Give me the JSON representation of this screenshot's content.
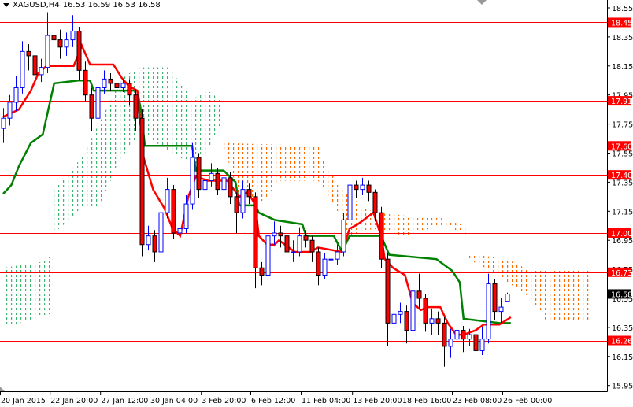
{
  "header": {
    "symbol": "XAGUSD,H4",
    "ohlc": "16.53 16.59 16.53 16.58"
  },
  "colors": {
    "bull": "#0000ff",
    "bear": "#ff0000",
    "tenkan": "#ff0000",
    "kijun": "#008000",
    "cloud_bull": "#3cb371",
    "cloud_bear": "#ff6a00",
    "level": "#ff0000",
    "current": "#708090"
  },
  "chart_data": {
    "type": "candlestick",
    "title": "XAGUSD,H4",
    "ylim": [
      15.9,
      18.6
    ],
    "y_ticks": [
      "18.55",
      "18.35",
      "18.15",
      "17.95",
      "17.75",
      "17.55",
      "17.35",
      "17.15",
      "16.95",
      "16.75",
      "16.55",
      "16.35",
      "16.15",
      "15.95"
    ],
    "x_ticks": [
      {
        "i": 0,
        "label": "20 Jan 2015"
      },
      {
        "i": 7.9,
        "label": "22 Jan 20:00"
      },
      {
        "i": 15.9,
        "label": "27 Jan 12:00"
      },
      {
        "i": 23.75,
        "label": "30 Jan 04:00"
      },
      {
        "i": 31.9,
        "label": "3 Feb 20:00"
      },
      {
        "i": 39.75,
        "label": "6 Feb 12:00"
      },
      {
        "i": 47.75,
        "label": "11 Feb 04:00"
      },
      {
        "i": 55.9,
        "label": "13 Feb 20:00"
      },
      {
        "i": 63.75,
        "label": "18 Feb 16:00"
      },
      {
        "i": 71.75,
        "label": "23 Feb 08:00"
      },
      {
        "i": 79.75,
        "label": "26 Feb 00:00"
      }
    ],
    "levels": [
      {
        "price": 18.45,
        "label": "18.45"
      },
      {
        "price": 17.91,
        "label": "17.91"
      },
      {
        "price": 17.6,
        "label": "17.60"
      },
      {
        "price": 17.4,
        "label": "17.40"
      },
      {
        "price": 17.0,
        "label": "17.00"
      },
      {
        "price": 16.73,
        "label": "16.73"
      },
      {
        "price": 16.26,
        "label": "16.26"
      }
    ],
    "current_price": {
      "price": 16.58,
      "label": "16.58"
    },
    "candles": [
      [
        17.72,
        17.86,
        17.62,
        17.79
      ],
      [
        17.79,
        17.95,
        17.74,
        17.9
      ],
      [
        17.9,
        18.08,
        17.84,
        18.0
      ],
      [
        18.0,
        18.32,
        17.96,
        18.25
      ],
      [
        18.25,
        18.3,
        18.12,
        18.22
      ],
      [
        18.22,
        18.26,
        18.02,
        18.09
      ],
      [
        18.09,
        18.2,
        18.04,
        18.14
      ],
      [
        18.14,
        18.52,
        18.1,
        18.36
      ],
      [
        18.36,
        18.42,
        18.26,
        18.33
      ],
      [
        18.33,
        18.4,
        18.2,
        18.28
      ],
      [
        18.28,
        18.38,
        18.22,
        18.33
      ],
      [
        18.33,
        18.5,
        18.28,
        18.39
      ],
      [
        18.39,
        18.42,
        18.05,
        18.12
      ],
      [
        18.12,
        18.18,
        17.9,
        17.95
      ],
      [
        17.95,
        18.0,
        17.7,
        17.79
      ],
      [
        17.79,
        18.05,
        17.75,
        18.0
      ],
      [
        18.0,
        18.12,
        17.96,
        18.06
      ],
      [
        18.06,
        18.1,
        17.98,
        18.03
      ],
      [
        18.03,
        18.08,
        17.94,
        18.0
      ],
      [
        18.0,
        18.06,
        17.97,
        18.03
      ],
      [
        18.03,
        18.06,
        17.88,
        17.95
      ],
      [
        17.95,
        17.99,
        17.7,
        17.79
      ],
      [
        17.79,
        17.85,
        16.84,
        16.92
      ],
      [
        16.92,
        17.05,
        16.88,
        16.98
      ],
      [
        16.98,
        17.02,
        16.8,
        16.87
      ],
      [
        16.87,
        17.2,
        16.84,
        17.14
      ],
      [
        17.14,
        17.38,
        17.1,
        17.3
      ],
      [
        17.3,
        17.33,
        16.96,
        17.0
      ],
      [
        17.0,
        17.08,
        16.95,
        17.03
      ],
      [
        17.03,
        17.26,
        17.0,
        17.2
      ],
      [
        17.2,
        17.62,
        17.16,
        17.52
      ],
      [
        17.52,
        17.55,
        17.24,
        17.3
      ],
      [
        17.3,
        17.42,
        17.26,
        17.36
      ],
      [
        17.36,
        17.48,
        17.32,
        17.41
      ],
      [
        17.41,
        17.45,
        17.26,
        17.3
      ],
      [
        17.3,
        17.44,
        17.26,
        17.38
      ],
      [
        17.38,
        17.42,
        17.2,
        17.25
      ],
      [
        17.25,
        17.28,
        17.0,
        17.14
      ],
      [
        17.14,
        17.36,
        17.1,
        17.3
      ],
      [
        17.3,
        17.34,
        17.2,
        17.25
      ],
      [
        17.25,
        17.28,
        16.62,
        16.76
      ],
      [
        16.76,
        16.8,
        16.64,
        16.71
      ],
      [
        16.71,
        17.04,
        16.68,
        16.98
      ],
      [
        16.98,
        17.08,
        16.92,
        17.0
      ],
      [
        17.0,
        17.05,
        16.9,
        16.98
      ],
      [
        16.98,
        17.02,
        16.72,
        16.87
      ],
      [
        16.87,
        16.95,
        16.8,
        16.87
      ],
      [
        16.87,
        17.04,
        16.84,
        16.98
      ],
      [
        16.98,
        17.02,
        16.9,
        16.95
      ],
      [
        16.95,
        16.98,
        16.8,
        16.87
      ],
      [
        16.87,
        16.9,
        16.64,
        16.71
      ],
      [
        16.71,
        16.86,
        16.68,
        16.82
      ],
      [
        16.82,
        16.88,
        16.76,
        16.82
      ],
      [
        16.82,
        16.92,
        16.78,
        16.87
      ],
      [
        16.87,
        17.14,
        16.84,
        17.09
      ],
      [
        17.09,
        17.4,
        17.05,
        17.33
      ],
      [
        17.33,
        17.36,
        17.24,
        17.3
      ],
      [
        17.3,
        17.38,
        17.26,
        17.33
      ],
      [
        17.33,
        17.36,
        17.22,
        17.28
      ],
      [
        17.28,
        17.3,
        17.08,
        17.14
      ],
      [
        17.14,
        17.18,
        16.76,
        16.82
      ],
      [
        16.82,
        16.86,
        16.22,
        16.38
      ],
      [
        16.38,
        16.5,
        16.34,
        16.44
      ],
      [
        16.44,
        16.52,
        16.38,
        16.46
      ],
      [
        16.46,
        16.5,
        16.24,
        16.33
      ],
      [
        16.33,
        16.68,
        16.3,
        16.6
      ],
      [
        16.6,
        16.72,
        16.48,
        16.55
      ],
      [
        16.55,
        16.58,
        16.32,
        16.38
      ],
      [
        16.38,
        16.48,
        16.3,
        16.41
      ],
      [
        16.41,
        16.46,
        16.3,
        16.38
      ],
      [
        16.38,
        16.42,
        16.08,
        16.22
      ],
      [
        16.22,
        16.34,
        16.14,
        16.27
      ],
      [
        16.27,
        16.38,
        16.24,
        16.33
      ],
      [
        16.33,
        16.36,
        16.18,
        16.27
      ],
      [
        16.27,
        16.34,
        16.22,
        16.3
      ],
      [
        16.3,
        16.33,
        16.06,
        16.19
      ],
      [
        16.19,
        16.35,
        16.16,
        16.27
      ],
      [
        16.27,
        16.72,
        16.24,
        16.65
      ],
      [
        16.65,
        16.68,
        16.4,
        16.46
      ],
      [
        16.46,
        16.55,
        16.38,
        16.49
      ],
      [
        16.53,
        16.59,
        16.53,
        16.58
      ]
    ],
    "tenkan_sen": [
      [
        0,
        17.8
      ],
      [
        2.5,
        17.85
      ],
      [
        4.4,
        17.98
      ],
      [
        5.6,
        18.1
      ],
      [
        6.9,
        18.15
      ],
      [
        11.2,
        18.15
      ],
      [
        12.5,
        18.29
      ],
      [
        13.8,
        18.16
      ],
      [
        17.5,
        18.16
      ],
      [
        18.8,
        18.07
      ],
      [
        20,
        18.01
      ],
      [
        21.3,
        17.98
      ],
      [
        22.3,
        17.52
      ],
      [
        23.8,
        17.3
      ],
      [
        25.6,
        17.17
      ],
      [
        26.9,
        17.03
      ],
      [
        28.1,
        16.98
      ],
      [
        29.4,
        17.25
      ],
      [
        30.6,
        17.39
      ],
      [
        32.5,
        17.36
      ],
      [
        35.6,
        17.36
      ],
      [
        37.5,
        17.25
      ],
      [
        38.8,
        17.28
      ],
      [
        40,
        17.2
      ],
      [
        40.6,
        16.98
      ],
      [
        41.9,
        16.92
      ],
      [
        43.1,
        16.92
      ],
      [
        43.8,
        16.95
      ],
      [
        46.3,
        16.87
      ],
      [
        48.8,
        16.87
      ],
      [
        50,
        16.9
      ],
      [
        53.8,
        16.87
      ],
      [
        55,
        17.03
      ],
      [
        56.3,
        17.06
      ],
      [
        58.8,
        17.14
      ],
      [
        60,
        16.98
      ],
      [
        60.6,
        16.82
      ],
      [
        61.9,
        16.76
      ],
      [
        63.8,
        16.71
      ],
      [
        65,
        16.52
      ],
      [
        66.3,
        16.47
      ],
      [
        67.5,
        16.49
      ],
      [
        69.4,
        16.49
      ],
      [
        70.6,
        16.38
      ],
      [
        71.9,
        16.3
      ],
      [
        73.1,
        16.3
      ],
      [
        75,
        16.33
      ],
      [
        76.3,
        16.37
      ],
      [
        78.8,
        16.37
      ],
      [
        80.6,
        16.42
      ]
    ],
    "kijun_sen": [
      [
        0,
        17.27
      ],
      [
        1.3,
        17.33
      ],
      [
        2.5,
        17.46
      ],
      [
        4.4,
        17.62
      ],
      [
        6.3,
        17.68
      ],
      [
        8.1,
        18.03
      ],
      [
        11.9,
        18.05
      ],
      [
        13.8,
        18.05
      ],
      [
        14.4,
        17.98
      ],
      [
        21.3,
        17.98
      ],
      [
        21.9,
        17.84
      ],
      [
        22.5,
        17.6
      ],
      [
        30,
        17.6
      ],
      [
        30.6,
        17.43
      ],
      [
        35,
        17.43
      ],
      [
        36.9,
        17.35
      ],
      [
        37.5,
        17.19
      ],
      [
        40,
        17.19
      ],
      [
        40.6,
        17.14
      ],
      [
        43.1,
        17.09
      ],
      [
        47.5,
        17.06
      ],
      [
        48.1,
        16.98
      ],
      [
        52.5,
        16.98
      ],
      [
        53.8,
        16.87
      ],
      [
        55,
        16.98
      ],
      [
        60,
        16.98
      ],
      [
        61.3,
        16.85
      ],
      [
        68.8,
        16.82
      ],
      [
        71.3,
        16.74
      ],
      [
        72.5,
        16.66
      ],
      [
        73.1,
        16.41
      ],
      [
        78.8,
        16.38
      ],
      [
        80.6,
        16.38
      ]
    ],
    "cloud": [
      {
        "kind": "bull",
        "top": [
          [
            0,
            16.76
          ],
          [
            6,
            16.8
          ],
          [
            8,
            16.85
          ]
        ],
        "bottom": [
          [
            0,
            16.35
          ],
          [
            8,
            16.45
          ]
        ]
      },
      {
        "kind": "bull",
        "top": [
          [
            8.1,
            17.3
          ],
          [
            12.5,
            17.52
          ],
          [
            18.8,
            18.06
          ],
          [
            21.3,
            18.14
          ],
          [
            26.3,
            18.14
          ],
          [
            30,
            17.92
          ],
          [
            32.5,
            17.98
          ],
          [
            35,
            17.9
          ]
        ],
        "bottom": [
          [
            8.1,
            17.0
          ],
          [
            12.5,
            17.17
          ],
          [
            15,
            17.17
          ],
          [
            18.8,
            17.52
          ],
          [
            21.9,
            17.7
          ],
          [
            25,
            17.6
          ],
          [
            30,
            17.47
          ],
          [
            31.3,
            17.47
          ],
          [
            35,
            17.78
          ]
        ]
      },
      {
        "kind": "bear",
        "top": [
          [
            35,
            17.62
          ],
          [
            50,
            17.6
          ],
          [
            51.3,
            17.44
          ],
          [
            52.5,
            17.4
          ]
        ],
        "bottom": [
          [
            35,
            17.6
          ],
          [
            37.5,
            17.25
          ],
          [
            41.3,
            17.22
          ],
          [
            43.8,
            17.36
          ],
          [
            50,
            17.36
          ],
          [
            52.5,
            17.2
          ]
        ]
      },
      {
        "kind": "bear",
        "top": [
          [
            52.5,
            17.36
          ],
          [
            55,
            17.25
          ],
          [
            58.8,
            17.14
          ],
          [
            63.8,
            17.12
          ],
          [
            70,
            17.1
          ],
          [
            73.8,
            17.04
          ]
        ],
        "bottom": [
          [
            52.5,
            17.2
          ],
          [
            55,
            16.98
          ],
          [
            58.8,
            17.03
          ],
          [
            63.8,
            16.98
          ],
          [
            70,
            17.06
          ],
          [
            73.8,
            16.98
          ]
        ]
      },
      {
        "kind": "bear",
        "top": [
          [
            73.8,
            16.86
          ],
          [
            80,
            16.82
          ],
          [
            83.8,
            16.74
          ],
          [
            93.5,
            16.74
          ]
        ],
        "bottom": [
          [
            73.8,
            16.82
          ],
          [
            77.5,
            16.74
          ],
          [
            83.8,
            16.55
          ],
          [
            86.3,
            16.39
          ],
          [
            93.5,
            16.39
          ]
        ]
      }
    ]
  }
}
